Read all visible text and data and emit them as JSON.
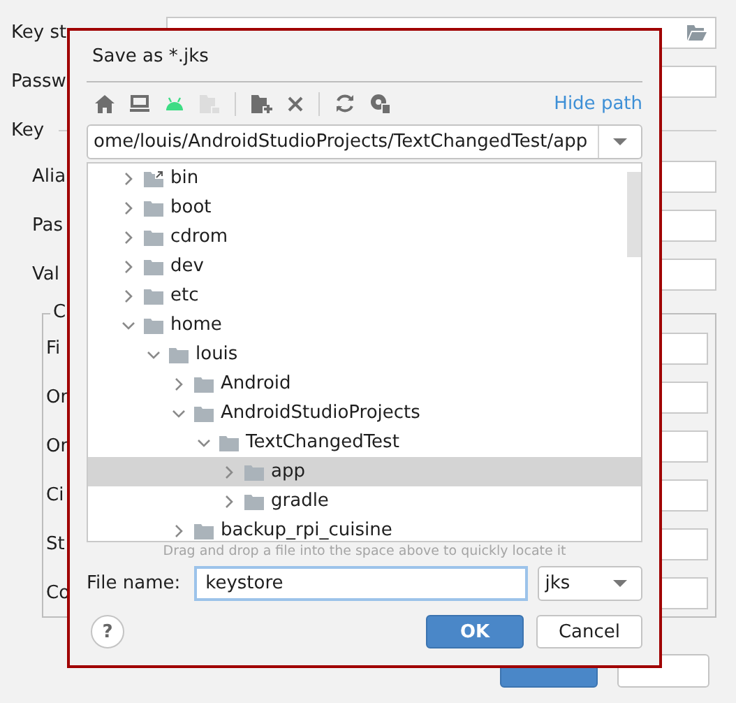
{
  "background_form": {
    "rows": [
      {
        "label": "Key st",
        "kind": "path"
      },
      {
        "label": "Passw",
        "kind": "field"
      },
      {
        "label": "Key",
        "kind": "section"
      },
      {
        "label": "Alia",
        "kind": "field"
      },
      {
        "label": "Pas",
        "kind": "field"
      },
      {
        "label": "Val",
        "kind": "field"
      }
    ],
    "group": {
      "title": "C",
      "rows": [
        {
          "label": "Fi"
        },
        {
          "label": "Or"
        },
        {
          "label": "Or"
        },
        {
          "label": "Ci"
        },
        {
          "label": "St"
        },
        {
          "label": "Co"
        }
      ]
    },
    "buttons": [
      {
        "kind": "primary"
      },
      {
        "kind": "secondary"
      }
    ]
  },
  "dialog": {
    "title": "Save as *.jks",
    "toolbar": [
      {
        "kind": "home",
        "disabled": false
      },
      {
        "kind": "desktop",
        "disabled": false
      },
      {
        "kind": "android",
        "disabled": false
      },
      {
        "kind": "module",
        "disabled": true
      },
      {
        "kind": "separator"
      },
      {
        "kind": "new-folder",
        "disabled": false
      },
      {
        "kind": "delete",
        "disabled": false
      },
      {
        "kind": "separator"
      },
      {
        "kind": "refresh",
        "disabled": false
      },
      {
        "kind": "hidden",
        "disabled": false
      }
    ],
    "hide_path_link": "Hide path",
    "path": "ome/louis/AndroidStudioProjects/TextChangedTest/app",
    "tree": [
      {
        "name": "bin",
        "kind": "symlink",
        "expanded": false,
        "selected": false
      },
      {
        "name": "boot",
        "kind": "folder",
        "expanded": false,
        "selected": false
      },
      {
        "name": "cdrom",
        "kind": "folder",
        "expanded": false,
        "selected": false
      },
      {
        "name": "dev",
        "kind": "folder",
        "expanded": false,
        "selected": false
      },
      {
        "name": "etc",
        "kind": "folder",
        "expanded": false,
        "selected": false
      },
      {
        "name": "home",
        "kind": "folder",
        "expanded": true,
        "selected": false,
        "children": [
          {
            "name": "louis",
            "kind": "folder",
            "expanded": true,
            "selected": false,
            "children": [
              {
                "name": "Android",
                "kind": "folder",
                "expanded": false,
                "selected": false
              },
              {
                "name": "AndroidStudioProjects",
                "kind": "folder",
                "expanded": true,
                "selected": false,
                "children": [
                  {
                    "name": "TextChangedTest",
                    "kind": "folder",
                    "expanded": true,
                    "selected": false,
                    "children": [
                      {
                        "name": "app",
                        "kind": "folder",
                        "expanded": false,
                        "selected": true
                      },
                      {
                        "name": "gradle",
                        "kind": "folder",
                        "expanded": false,
                        "selected": false
                      }
                    ]
                  }
                ]
              },
              {
                "name": "backup_rpi_cuisine",
                "kind": "folder",
                "expanded": false,
                "selected": false
              }
            ]
          }
        ]
      }
    ],
    "hint": "Drag and drop a file into the space above to quickly locate it",
    "file_name_label": "File name:",
    "file_name": "keystore",
    "file_type": "jks",
    "help_button": "?",
    "buttons": [
      {
        "label": "OK",
        "kind": "primary"
      },
      {
        "label": "Cancel",
        "kind": "secondary"
      }
    ]
  }
}
